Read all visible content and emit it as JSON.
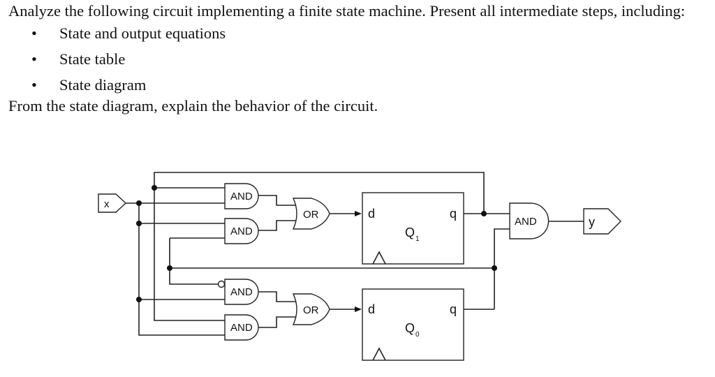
{
  "question": {
    "intro": "Analyze the following circuit implementing a finite state machine. Present all intermediate steps, including:",
    "items": [
      "State and output equations",
      "State table",
      "State diagram"
    ],
    "bullet": "•",
    "outro": "From the state diagram, explain the behavior of the circuit."
  },
  "circuit": {
    "input_label": "x",
    "output_label": "y",
    "gates": {
      "and1": "AND",
      "and2": "AND",
      "and3": "AND",
      "and4": "AND",
      "or1": "OR",
      "or2": "OR",
      "and_out": "AND"
    },
    "flipflops": {
      "q1": {
        "d": "d",
        "q": "q",
        "name": "Q",
        "sub": "1"
      },
      "q0": {
        "d": "d",
        "q": "q",
        "name": "Q",
        "sub": "0"
      }
    }
  }
}
